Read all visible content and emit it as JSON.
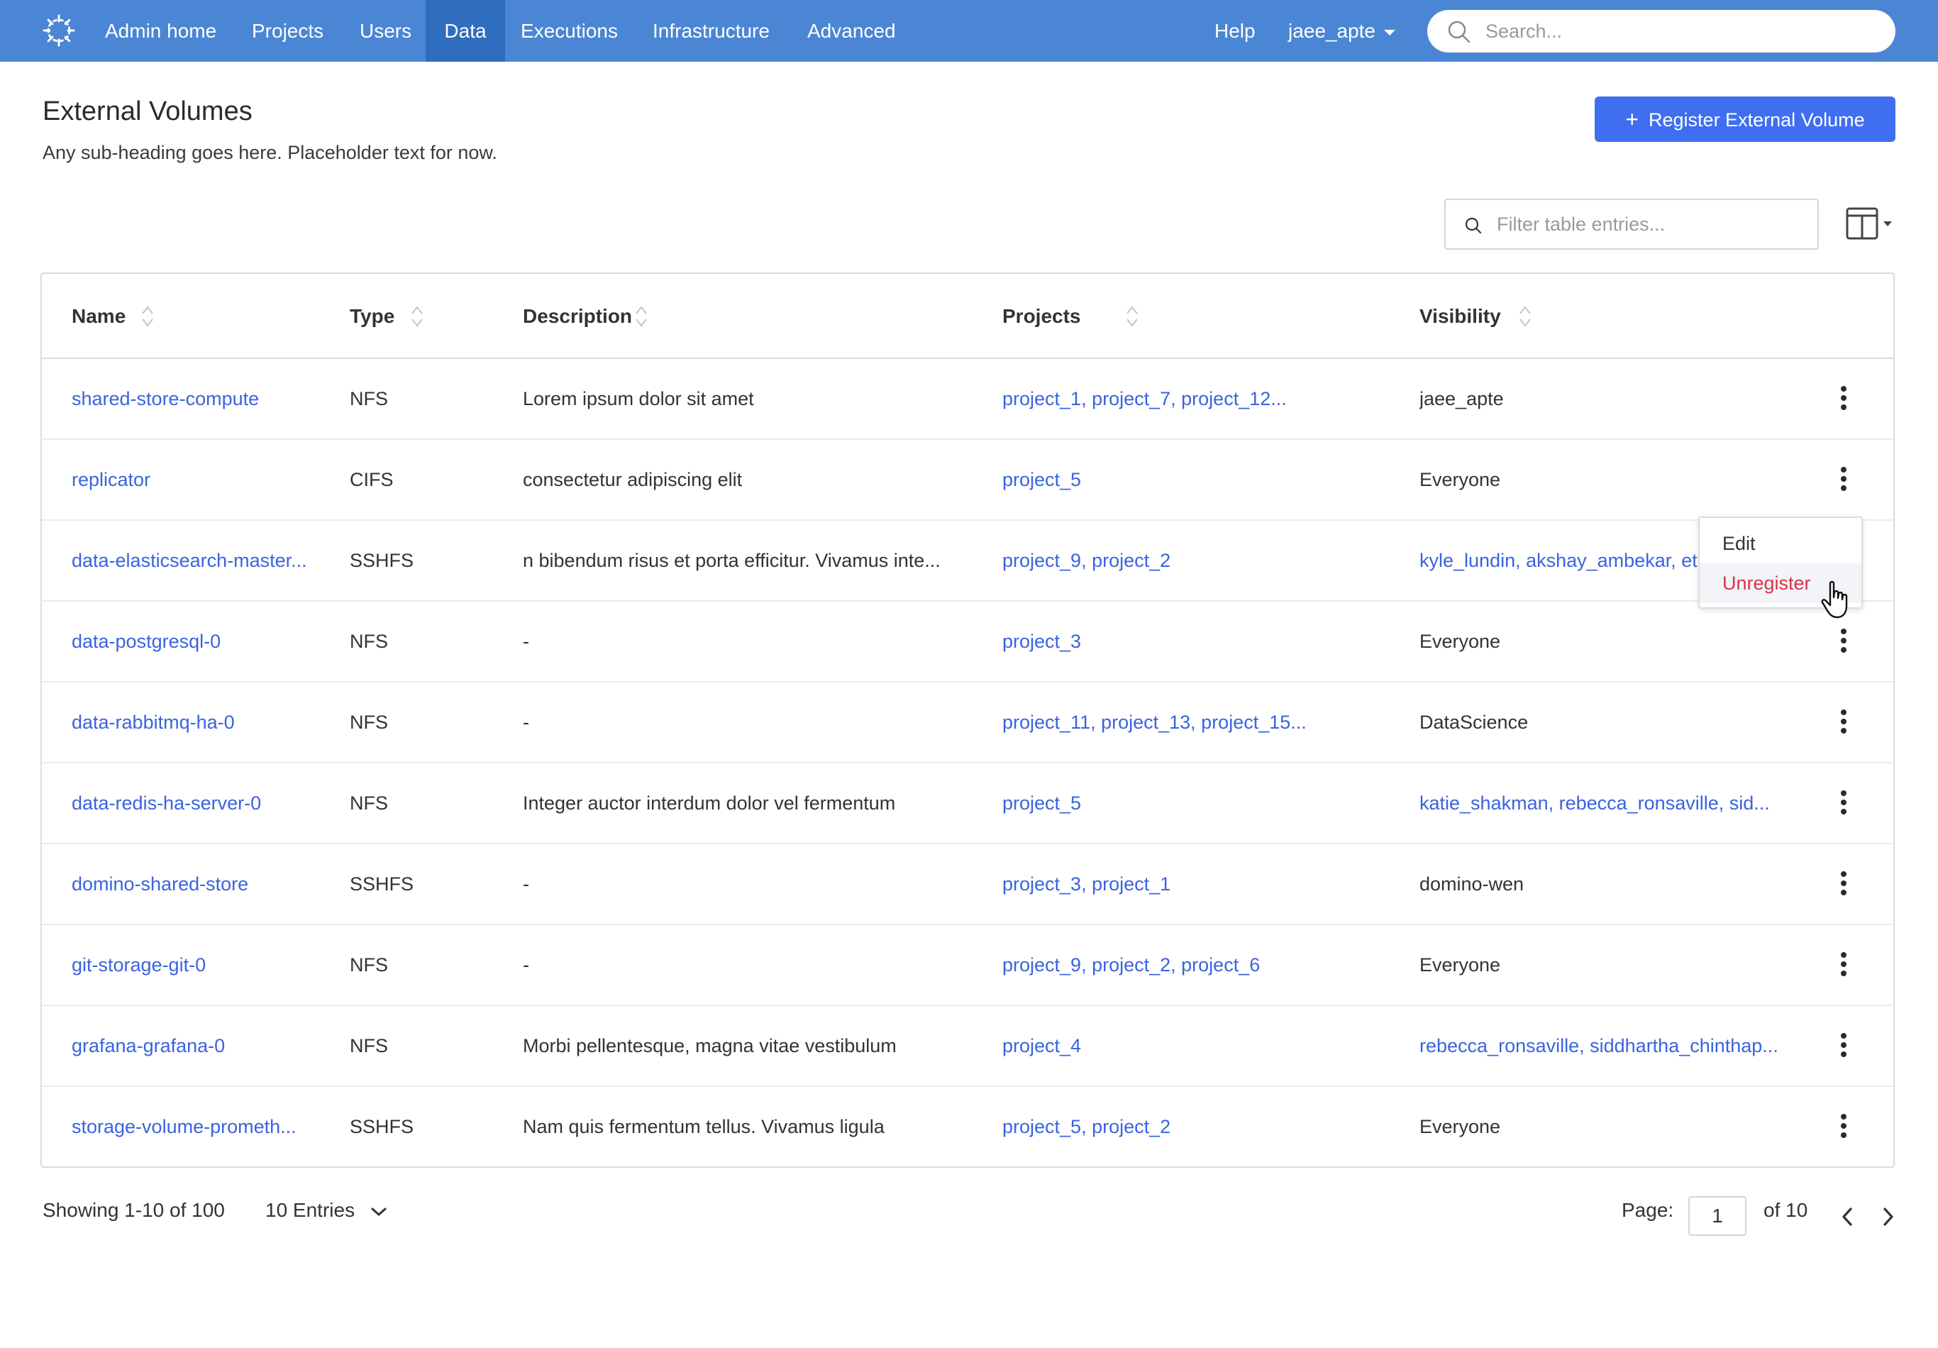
{
  "nav": {
    "items": [
      {
        "label": "Admin home",
        "active": false
      },
      {
        "label": "Projects",
        "active": false
      },
      {
        "label": "Users",
        "active": false
      },
      {
        "label": "Data",
        "active": true
      },
      {
        "label": "Executions",
        "active": false
      },
      {
        "label": "Infrastructure",
        "active": false
      },
      {
        "label": "Advanced",
        "active": false
      }
    ],
    "help": "Help",
    "user": "jaee_apte",
    "search_placeholder": "Search..."
  },
  "header": {
    "title": "External Volumes",
    "subtitle": "Any sub-heading goes here. Placeholder text for now.",
    "register_button": "Register External Volume"
  },
  "filter": {
    "placeholder": "Filter table entries..."
  },
  "table": {
    "columns": [
      "Name",
      "Type",
      "Description",
      "Projects",
      "Visibility"
    ],
    "rows": [
      {
        "name": "shared-store-compute",
        "type": "NFS",
        "description": "Lorem ipsum dolor sit amet",
        "projects": "project_1, project_7, project_12...",
        "visibility": "jaee_apte",
        "visibility_link": false
      },
      {
        "name": "replicator",
        "type": "CIFS",
        "description": "consectetur adipiscing elit",
        "projects": "project_5",
        "visibility": "Everyone",
        "visibility_link": false
      },
      {
        "name": "data-elasticsearch-master...",
        "type": "SSHFS",
        "description": "n bibendum risus et porta efficitur. Vivamus inte...",
        "projects": "project_9, project_2",
        "visibility": "kyle_lundin, akshay_ambekar, et",
        "visibility_link": true
      },
      {
        "name": "data-postgresql-0",
        "type": "NFS",
        "description": "-",
        "projects": "project_3",
        "visibility": "Everyone",
        "visibility_link": false
      },
      {
        "name": "data-rabbitmq-ha-0",
        "type": "NFS",
        "description": "-",
        "projects": "project_11, project_13, project_15...",
        "visibility": "DataScience",
        "visibility_link": false
      },
      {
        "name": "data-redis-ha-server-0",
        "type": "NFS",
        "description": "Integer auctor interdum dolor vel fermentum",
        "projects": "project_5",
        "visibility": "katie_shakman, rebecca_ronsaville, sid...",
        "visibility_link": true
      },
      {
        "name": "domino-shared-store",
        "type": "SSHFS",
        "description": "-",
        "projects": "project_3, project_1",
        "visibility": "domino-wen",
        "visibility_link": false
      },
      {
        "name": "git-storage-git-0",
        "type": "NFS",
        "description": "-",
        "projects": "project_9, project_2, project_6",
        "visibility": "Everyone",
        "visibility_link": false
      },
      {
        "name": "grafana-grafana-0",
        "type": "NFS",
        "description": "Morbi pellentesque, magna vitae vestibulum",
        "projects": "project_4",
        "visibility": "rebecca_ronsaville, siddhartha_chinthap...",
        "visibility_link": true
      },
      {
        "name": "storage-volume-prometh...",
        "type": "SSHFS",
        "description": "Nam quis fermentum tellus. Vivamus ligula",
        "projects": "project_5, project_2",
        "visibility": "Everyone",
        "visibility_link": false
      }
    ]
  },
  "row_menu": {
    "edit": "Edit",
    "unregister": "Unregister"
  },
  "footer": {
    "showing": "Showing 1-10 of 100",
    "entries": "10 Entries",
    "page_label": "Page:",
    "page_value": "1",
    "of_pages": "of 10"
  },
  "colors": {
    "nav_bg": "#4a86d4",
    "nav_active": "#2f6dbf",
    "primary": "#3f6ff0",
    "link": "#3a63e0",
    "danger": "#d9324b"
  }
}
